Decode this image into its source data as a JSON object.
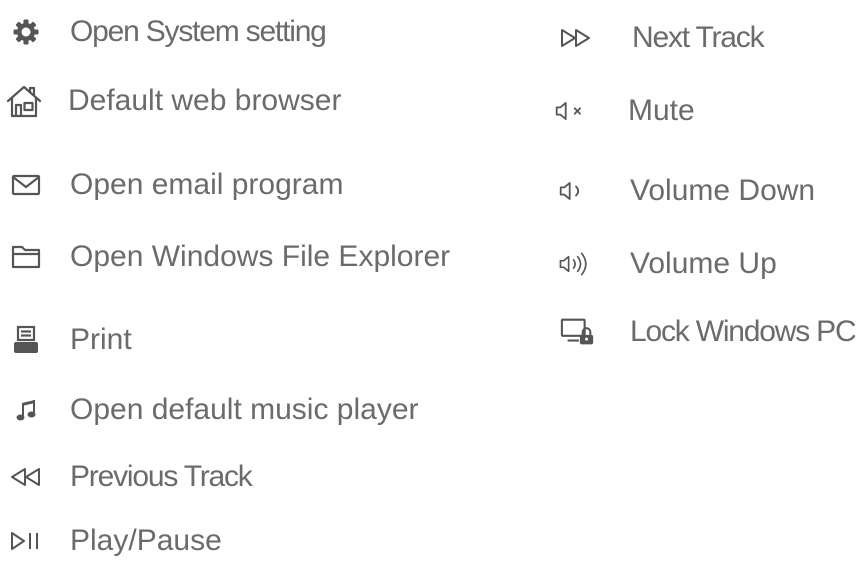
{
  "left_items": [
    {
      "id": "system-settings",
      "icon": "gear-icon",
      "label": "Open System setting"
    },
    {
      "id": "web-browser",
      "icon": "home-icon",
      "label": "Default web browser"
    },
    {
      "id": "email",
      "icon": "envelope-icon",
      "label": "Open email program"
    },
    {
      "id": "file-explorer",
      "icon": "folder-icon",
      "label": "Open Windows File Explorer"
    },
    {
      "id": "print",
      "icon": "printer-icon",
      "label": "Print"
    },
    {
      "id": "music-player",
      "icon": "music-note-icon",
      "label": "Open default music player"
    },
    {
      "id": "previous-track",
      "icon": "previous-track-icon",
      "label": "Previous Track"
    },
    {
      "id": "play-pause",
      "icon": "play-pause-icon",
      "label": "Play/Pause"
    }
  ],
  "right_items": [
    {
      "id": "next-track",
      "icon": "next-track-icon",
      "label": "Next Track"
    },
    {
      "id": "mute",
      "icon": "mute-icon",
      "label": "Mute"
    },
    {
      "id": "volume-down",
      "icon": "volume-down-icon",
      "label": "Volume Down"
    },
    {
      "id": "volume-up",
      "icon": "volume-up-icon",
      "label": "Volume Up"
    },
    {
      "id": "lock-pc",
      "icon": "lock-pc-icon",
      "label": "Lock Windows PC"
    }
  ],
  "colors": {
    "text": "#6b6b6b",
    "icon": "#555555"
  }
}
